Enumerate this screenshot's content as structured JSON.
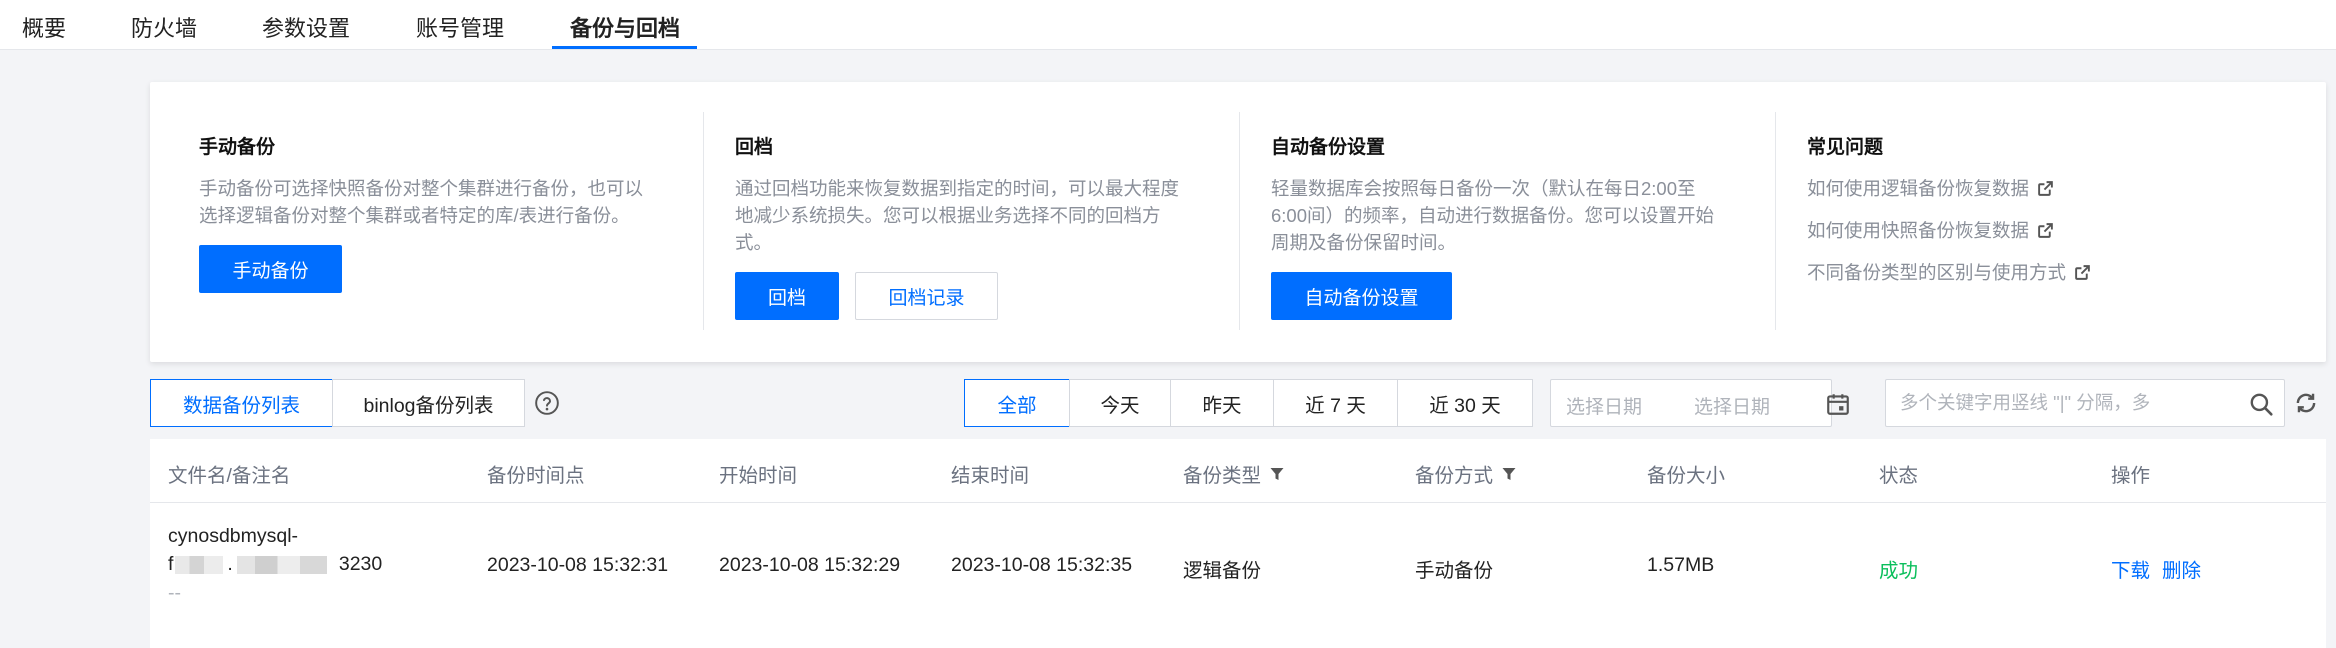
{
  "tabs": [
    {
      "label": "概要"
    },
    {
      "label": "防火墙"
    },
    {
      "label": "参数设置"
    },
    {
      "label": "账号管理"
    },
    {
      "label": "备份与回档"
    }
  ],
  "active_tab": "备份与回档",
  "accent_color": "#006eff",
  "info_card": {
    "manual": {
      "title": "手动备份",
      "desc_line1": "手动备份可选择快照备份对整个集群进行备份，也可以",
      "desc_line2": "选择逻辑备份对整个集群或者特定的库/表进行备份。",
      "button": "手动备份"
    },
    "rollback": {
      "title": "回档",
      "desc_line1": "通过回档功能来恢复数据到指定的时间，可以最大程度",
      "desc_line2": "地减少系统损失。您可以根据业务选择不同的回档方",
      "desc_line3": "式。",
      "button": "回档",
      "record_button": "回档记录"
    },
    "auto": {
      "title": "自动备份设置",
      "desc_line1": "轻量数据库会按照每日备份一次（默认在每日2:00至",
      "desc_line2": "6:00间）的频率，自动进行数据备份。您可以设置开始",
      "desc_line3": "周期及备份保留时间。",
      "button": "自动备份设置"
    },
    "faq": {
      "title": "常见问题",
      "links": [
        {
          "label": "如何使用逻辑备份恢复数据"
        },
        {
          "label": "如何使用快照备份恢复数据"
        },
        {
          "label": "不同备份类型的区别与使用方式"
        }
      ]
    }
  },
  "toolbar": {
    "list_tabs": [
      "数据备份列表",
      "binlog备份列表"
    ],
    "active_list_tab": "数据备份列表",
    "range_buttons": [
      "全部",
      "今天",
      "昨天",
      "近 7 天",
      "近 30 天"
    ],
    "active_range": "全部",
    "date_start_placeholder": "选择日期",
    "date_end_placeholder": "选择日期",
    "search_placeholder": "多个关键字用竖线 \"|\" 分隔，多"
  },
  "table": {
    "headers": {
      "file": "文件名/备注名",
      "backup_point": "备份时间点",
      "start": "开始时间",
      "end": "结束时间",
      "type": "备份类型",
      "method": "备份方式",
      "size": "备份大小",
      "status": "状态",
      "ops": "操作"
    },
    "rows": [
      {
        "file_line1": "cynosdbmysql-",
        "file_prefix": "f",
        "file_mid": ".",
        "file_suffix": "3230",
        "note": "--",
        "backup_point": "2023-10-08 15:32:31",
        "start": "2023-10-08 15:32:29",
        "end": "2023-10-08 15:32:35",
        "type": "逻辑备份",
        "method": "手动备份",
        "size": "1.57MB",
        "status": "成功",
        "op_download": "下载",
        "op_delete": "删除"
      }
    ]
  }
}
